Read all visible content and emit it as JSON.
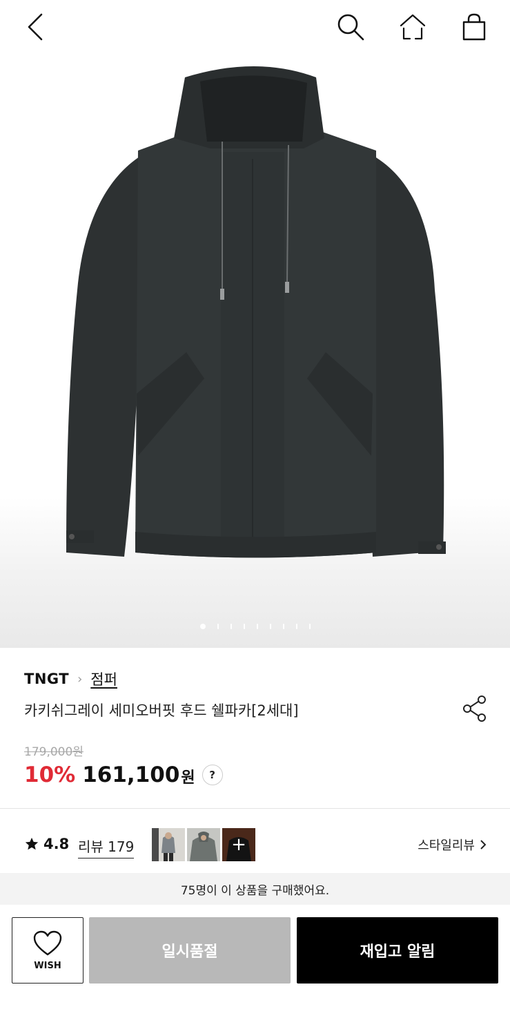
{
  "nav": {
    "back_icon": "chevron-left-icon",
    "search_icon": "search-icon",
    "home_icon": "home-icon",
    "cart_icon": "shopping-bag-icon"
  },
  "gallery": {
    "image": "dark charcoal hooded parka product photo",
    "total_pages": 10,
    "current_page": 1
  },
  "product": {
    "brand": "TNGT",
    "category": "점퍼",
    "title": "카키쉬그레이 세미오버핏 후드 쉘파카[2세대]",
    "original_price": "179,000원",
    "discount": "10%",
    "price": "161,100",
    "currency": "원",
    "help_label": "?"
  },
  "reviews": {
    "rating": "4.8",
    "review_label": "리뷰 179",
    "style_review_label": "스타일리뷰",
    "thumb_more": "+"
  },
  "buyers_text": "75명이 이 상품을 구매했어요.",
  "actions": {
    "wish_label": "WISH",
    "soldout_label": "일시품절",
    "restock_label": "재입고 알림"
  },
  "colors": {
    "discount": "#e02b36",
    "soldout_bg": "#b8b8b8",
    "restock_bg": "#000000"
  }
}
